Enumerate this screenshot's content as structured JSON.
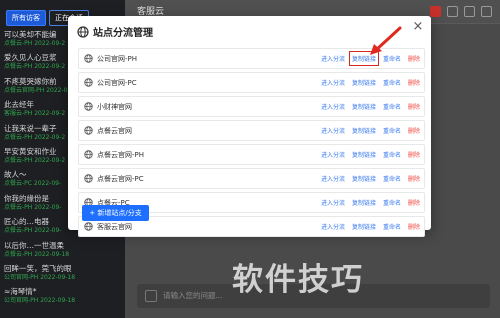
{
  "sidebar": {
    "tabs": [
      "所有访客",
      "正在会话"
    ],
    "conversations": [
      {
        "title": "可以美却不能编",
        "sub": "点餐云-PH   2022-09-2"
      },
      {
        "title": "爱久见人心豆浆",
        "sub": "点餐云-PH   2022-09-2"
      },
      {
        "title": "不疼莫哭嫁你前",
        "sub": "点餐云官网-PH   2022-0"
      },
      {
        "title": "此去经年",
        "sub": "客服云-PH   2022-09-2"
      },
      {
        "title": "让我来说一辈子",
        "sub": "点餐云-PH   2022-09-2"
      },
      {
        "title": "早安黄安和作业",
        "sub": "点餐云-PH   2022-09-2"
      },
      {
        "title": "故人～",
        "sub": "点餐云-PC   2022-09-"
      },
      {
        "title": "你我的缘份是",
        "sub": "点餐云-PH   2022-09-"
      },
      {
        "title": "匠心的…电器",
        "sub": "点餐云-PH   2022-09-"
      },
      {
        "title": "以后你…一世温柔",
        "sub": "点餐云-PH   2022-09-18"
      },
      {
        "title": "回眸一笑，莞飞的眼",
        "sub": "公司官网-PH   2022-09-18"
      },
      {
        "title": "≈海琴情*",
        "sub": "公司官网-PH   2022-09-18"
      }
    ]
  },
  "chat": {
    "name": "客服云",
    "input_placeholder": "请输入您的问题..."
  },
  "watermark": "软件技巧",
  "modal": {
    "title": "站点分流管理",
    "close_label": "×",
    "actions": {
      "enter": "进入分流",
      "copy": "复制链接",
      "rename": "重命名",
      "delete": "删除"
    },
    "sites": [
      {
        "name": "公司官网-PH",
        "highlight_copy": true
      },
      {
        "name": "公司官网-PC",
        "highlight_copy": false
      },
      {
        "name": "小财神官网",
        "highlight_copy": false
      },
      {
        "name": "点餐云官网",
        "highlight_copy": false
      },
      {
        "name": "点餐云官网-PH",
        "highlight_copy": false
      },
      {
        "name": "点餐云官网-PC",
        "highlight_copy": false
      },
      {
        "name": "点餐云-PC",
        "highlight_copy": false
      },
      {
        "name": "客服云官网",
        "highlight_copy": false
      }
    ],
    "add_button": "+ 新增站点/分支"
  },
  "colors": {
    "accent": "#1e6fff",
    "link": "#3a7bf0",
    "danger": "#f04a3f",
    "highlight_box": "#d8281e"
  },
  "icons": [
    "globe-icon",
    "close-icon",
    "arrow-annotation-icon",
    "emoji-icon"
  ]
}
